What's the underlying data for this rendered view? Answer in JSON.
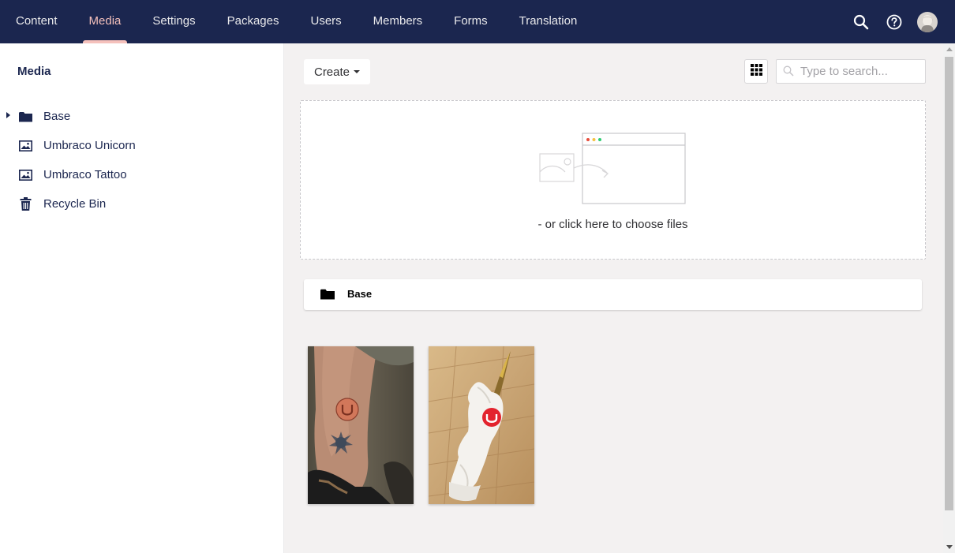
{
  "topnav": {
    "items": [
      {
        "label": "Content"
      },
      {
        "label": "Media"
      },
      {
        "label": "Settings"
      },
      {
        "label": "Packages"
      },
      {
        "label": "Users"
      },
      {
        "label": "Members"
      },
      {
        "label": "Forms"
      },
      {
        "label": "Translation"
      }
    ],
    "active": "Media",
    "icons": [
      "search-icon",
      "help-icon",
      "user-avatar"
    ]
  },
  "sidebar": {
    "title": "Media",
    "items": [
      {
        "label": "Base",
        "icon": "folder-icon",
        "has_children": true
      },
      {
        "label": "Umbraco Unicorn",
        "icon": "image-icon"
      },
      {
        "label": "Umbraco Tattoo",
        "icon": "image-icon"
      },
      {
        "label": "Recycle Bin",
        "icon": "trash-icon"
      }
    ]
  },
  "main": {
    "create_label": "Create",
    "search_placeholder": "Type to search...",
    "dropzone_text": "- or click here to choose files",
    "folders": [
      {
        "label": "Base",
        "icon": "folder-icon"
      }
    ],
    "media_items": [
      {
        "name": "Umbraco Tattoo",
        "kind": "photo"
      },
      {
        "name": "Umbraco Unicorn",
        "kind": "photo"
      }
    ]
  },
  "colors": {
    "nav_bg": "#1b264f",
    "nav_active": "#f5c1bc",
    "page_bg": "#f3f1f1",
    "text": "#1b264f"
  }
}
